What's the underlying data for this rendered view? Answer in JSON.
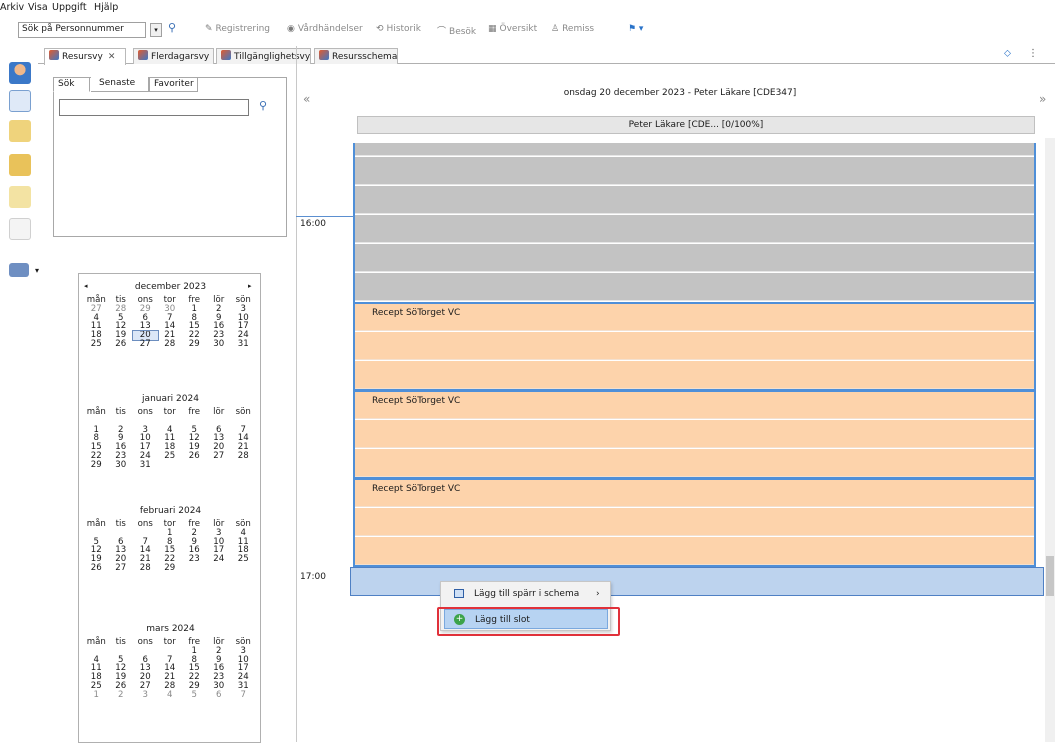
{
  "menubar": {
    "items": [
      "Arkiv",
      "Visa",
      "Uppgift",
      "Hjälp"
    ]
  },
  "toolbar": {
    "search_combo_value": "Sök på Personnummer",
    "buttons": [
      "Registrering",
      "Vårdhändelser",
      "Historik",
      "Besök",
      "Översikt",
      "Remiss"
    ]
  },
  "tabs": [
    {
      "label": "Resursvy",
      "close": "✕"
    },
    {
      "label": "Flerdagarsvy"
    },
    {
      "label": "Tillgänglighetsvy"
    },
    {
      "label": "Resursschema"
    }
  ],
  "search_panel": {
    "tabs": [
      "Sök",
      "Senaste",
      "Favoriter"
    ],
    "input_value": ""
  },
  "calendar": {
    "prev_arrow": "◂",
    "next_arrow": "▸",
    "weekdays": [
      "mån",
      "tis",
      "ons",
      "tor",
      "fre",
      "lör",
      "sön"
    ],
    "months": [
      {
        "title": "december 2023",
        "rows": [
          [
            "27",
            "28",
            "29",
            "30",
            "1",
            "2",
            "3"
          ],
          [
            "4",
            "5",
            "6",
            "7",
            "8",
            "9",
            "10"
          ],
          [
            "11",
            "12",
            "13",
            "14",
            "15",
            "16",
            "17"
          ],
          [
            "18",
            "19",
            "20",
            "21",
            "22",
            "23",
            "24"
          ],
          [
            "25",
            "26",
            "27",
            "28",
            "29",
            "30",
            "31"
          ]
        ]
      },
      {
        "title": "januari 2024",
        "rows": [
          [
            "",
            "",
            "",
            "",
            "",
            "",
            ""
          ],
          [
            "1",
            "2",
            "3",
            "4",
            "5",
            "6",
            "7"
          ],
          [
            "8",
            "9",
            "10",
            "11",
            "12",
            "13",
            "14"
          ],
          [
            "15",
            "16",
            "17",
            "18",
            "19",
            "20",
            "21"
          ],
          [
            "22",
            "23",
            "24",
            "25",
            "26",
            "27",
            "28"
          ],
          [
            "29",
            "30",
            "31",
            "",
            "",
            "",
            ""
          ]
        ]
      },
      {
        "title": "februari 2024",
        "rows": [
          [
            "",
            "",
            "",
            "1",
            "2",
            "3",
            "4"
          ],
          [
            "5",
            "6",
            "7",
            "8",
            "9",
            "10",
            "11"
          ],
          [
            "12",
            "13",
            "14",
            "15",
            "16",
            "17",
            "18"
          ],
          [
            "19",
            "20",
            "21",
            "22",
            "23",
            "24",
            "25"
          ],
          [
            "26",
            "27",
            "28",
            "29",
            "",
            "",
            ""
          ]
        ]
      },
      {
        "title": "mars 2024",
        "rows": [
          [
            "",
            "",
            "",
            "",
            "1",
            "2",
            "3"
          ],
          [
            "4",
            "5",
            "6",
            "7",
            "8",
            "9",
            "10"
          ],
          [
            "11",
            "12",
            "13",
            "14",
            "15",
            "16",
            "17"
          ],
          [
            "18",
            "19",
            "20",
            "21",
            "22",
            "23",
            "24"
          ],
          [
            "25",
            "26",
            "27",
            "28",
            "29",
            "30",
            "31"
          ],
          [
            "1",
            "2",
            "3",
            "4",
            "5",
            "6",
            "7"
          ]
        ]
      }
    ]
  },
  "schedule": {
    "nav_prev": "«",
    "nav_next": "»",
    "header": "onsdag 20 december 2023 - Peter Läkare [CDE347]",
    "resource": "Peter Läkare [CDE... [0/100%]",
    "times": [
      "16:00",
      "17:00"
    ],
    "blocks": [
      "Recept SöTorget VC",
      "Recept SöTorget VC",
      "Recept SöTorget VC"
    ]
  },
  "context_menu": {
    "items": [
      {
        "label": "Lägg till spärr i schema",
        "arrow": "›"
      },
      {
        "label": "Lägg till slot"
      }
    ]
  },
  "colors": {
    "accent": "#4f8fd8",
    "busy": "#c3c3c3",
    "slot": "#fdd3ab",
    "highlight": "#e0313a"
  }
}
